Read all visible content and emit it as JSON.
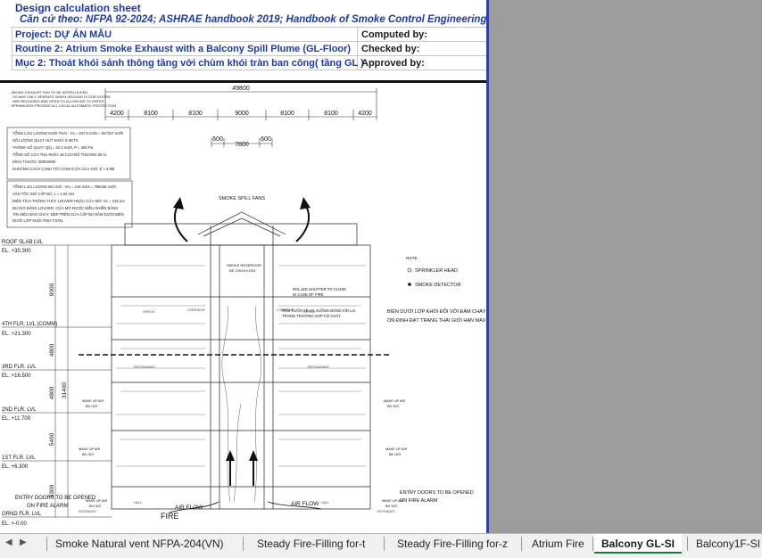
{
  "header": {
    "title": "Design calculation sheet",
    "basis": "Căn cứ theo: NFPA 92-2024; ASHRAE handbook 2019;  Handbook of Smoke Control Engineering ( John H. Klote)",
    "project_label": "Project: DỰ ÁN MẪU",
    "routine_label": "Routine 2: Atrium Smoke Exhaust with a Balcony Spill Plume (GL-Floor)",
    "item_label": "Mục 2: Thoát khói sảnh thông tầng với chùm khói tràn ban công( tầng GL )",
    "computed_by": "Computed by:",
    "checked_by": "Checked by:",
    "approved_by": "Approved by:"
  },
  "drawing": {
    "notes_top": [
      "- SMOKE EXHAUST FAN TO BE INTERLOCKED",
      "SO MAY ONLY OPERATE WHEN GROUND FLOOR DOORS",
      "ARE RELEASED AND OPEN TO ALLOW AIR TO ENTER",
      "- SPRINKLERS PROVIDE ALL LOCAL AUTOMATIC PROTECTION"
    ],
    "notes_box1": [
      "TỔNG LƯU LƯỢNG KHÓI THẢI : Vs = 257.8 m3/s = 927327 m3/h",
      "SỐ LƯỢNG QUẠT HÚT KHÓI: 8 SETS",
      "THÔNG SỐ QUẠT: Q/q = 32.2 m3/s, P = 400 Pa",
      "TỔNG SỐ CỬA THU KHÓI: 16 CỬA ĐỘ THOÁNG 65 %,",
      "KÍCH THƯỚC: 5000X800",
      "KHOẢNG CÁCH CẠNH TỚI CẠNH CỬA CỬA GIÓ: E > 3.8M"
    ],
    "notes_box2": [
      "TỔNG LƯU LƯỢNG BÙ GIÓ : Vm = 219 m3/s = 788238 m3/h",
      "VẬN TỐC GIÓ CẤP BÙ: v = 1.02 m/s",
      "DIỆN TÍCH THÔNG THỦY LOUVER HOẶC CỬA MỞ: Sc = 215 m2",
      "BÙ GIÓ BẰNG LOUVER, CỬA MỞ ĐƯỢC ĐIỀU KHIỂN BẰNG",
      "TÍN HIỆU BÁO CHÁY, MEP TRÊN CỬA CẤP BÙ NẰM DƯỚI BIÊN",
      "DƯỚI LỚP KHÓI TÍNH TOÁN."
    ],
    "total_width": "49800",
    "spans": [
      "4200",
      "8100",
      "8100",
      "9000",
      "8100",
      "8100",
      "4200"
    ],
    "dim_600a": "600",
    "dim_7800": "7800",
    "dim_600b": "600",
    "smoke_fans": "SMOKE SPILL FANS",
    "reservoir": [
      "SMOKE RESERVOIR",
      "BỂ CHỨA KHÓI"
    ],
    "shutter": [
      "ROLLED SHUTTER TO CLOSE",
      "IN CASE OF FIRE",
      "RÈM CUỐN SẼ HẠ XUỐNG ĐÓNG KÍN LẠI",
      "TRONG TRƯỜNG HỢP CÓ CHÁY"
    ],
    "boundary": [
      "BIÊN DƯỚI LỚP KHÓI ĐỐI VỚI ĐÁM CHÁY",
      "ỔN ĐỊNH ĐẠT TRẠNG THÁI GIỚI HẠN MAX"
    ],
    "legend_note": "NOTE:",
    "legend_sprinkler": "SPRINKLER HEAD",
    "legend_detector": "SMOKE DETECTOR",
    "levels": [
      {
        "name": "ROOF SLAB LVL",
        "el": "EL. +30.300"
      },
      {
        "name": "4TH FLR. LVL (COMM)",
        "el": "EL. +21.300"
      },
      {
        "name": "3RD FLR. LVL",
        "el": "EL. +16.500"
      },
      {
        "name": "2ND FLR. LVL",
        "el": "EL. +11.700"
      },
      {
        "name": "1ST FLR. LVL",
        "el": "EL. +6.300"
      },
      {
        "name": "GRND FLR. LVL",
        "el": "EL. +-0.00"
      }
    ],
    "heights": [
      "9000",
      "4800",
      "4800",
      "5400",
      "6300"
    ],
    "total_height": "31400",
    "makeup": [
      "MAKE UP AIR",
      "BÙ GIÓ"
    ],
    "entry_doors_left": [
      "ENTRY DOORS TO BE OPENED",
      "ON FIRE ALARM"
    ],
    "entry_doors_right": [
      "ENTRY DOORS TO BE OPENED",
      "ON FIRE ALARM"
    ],
    "fire": "FIRE",
    "air_flow_left": "AIR FLOW",
    "air_flow_right": "AIR FLOW",
    "restaurant": "RESTAURANT",
    "corridor": "CORRIDOR",
    "office": "OFFICE",
    "hall": "HALL",
    "entrance": "ENTRANCE"
  },
  "tabs": {
    "items": [
      "Smoke Natural vent NFPA-204(VN)",
      "Steady Fire-Filling for-t",
      "Steady Fire-Filling for-z",
      "Atrium Fire",
      "Balcony GL-SI",
      "Balcony1F-SI"
    ],
    "active": "Balcony GL-SI"
  },
  "colors": {
    "header_blue": "#1f3aa8",
    "page_break_blue": "#1f3fd6",
    "gray_area": "#9c9c9c",
    "active_tab_green": "#1a7a3a"
  }
}
